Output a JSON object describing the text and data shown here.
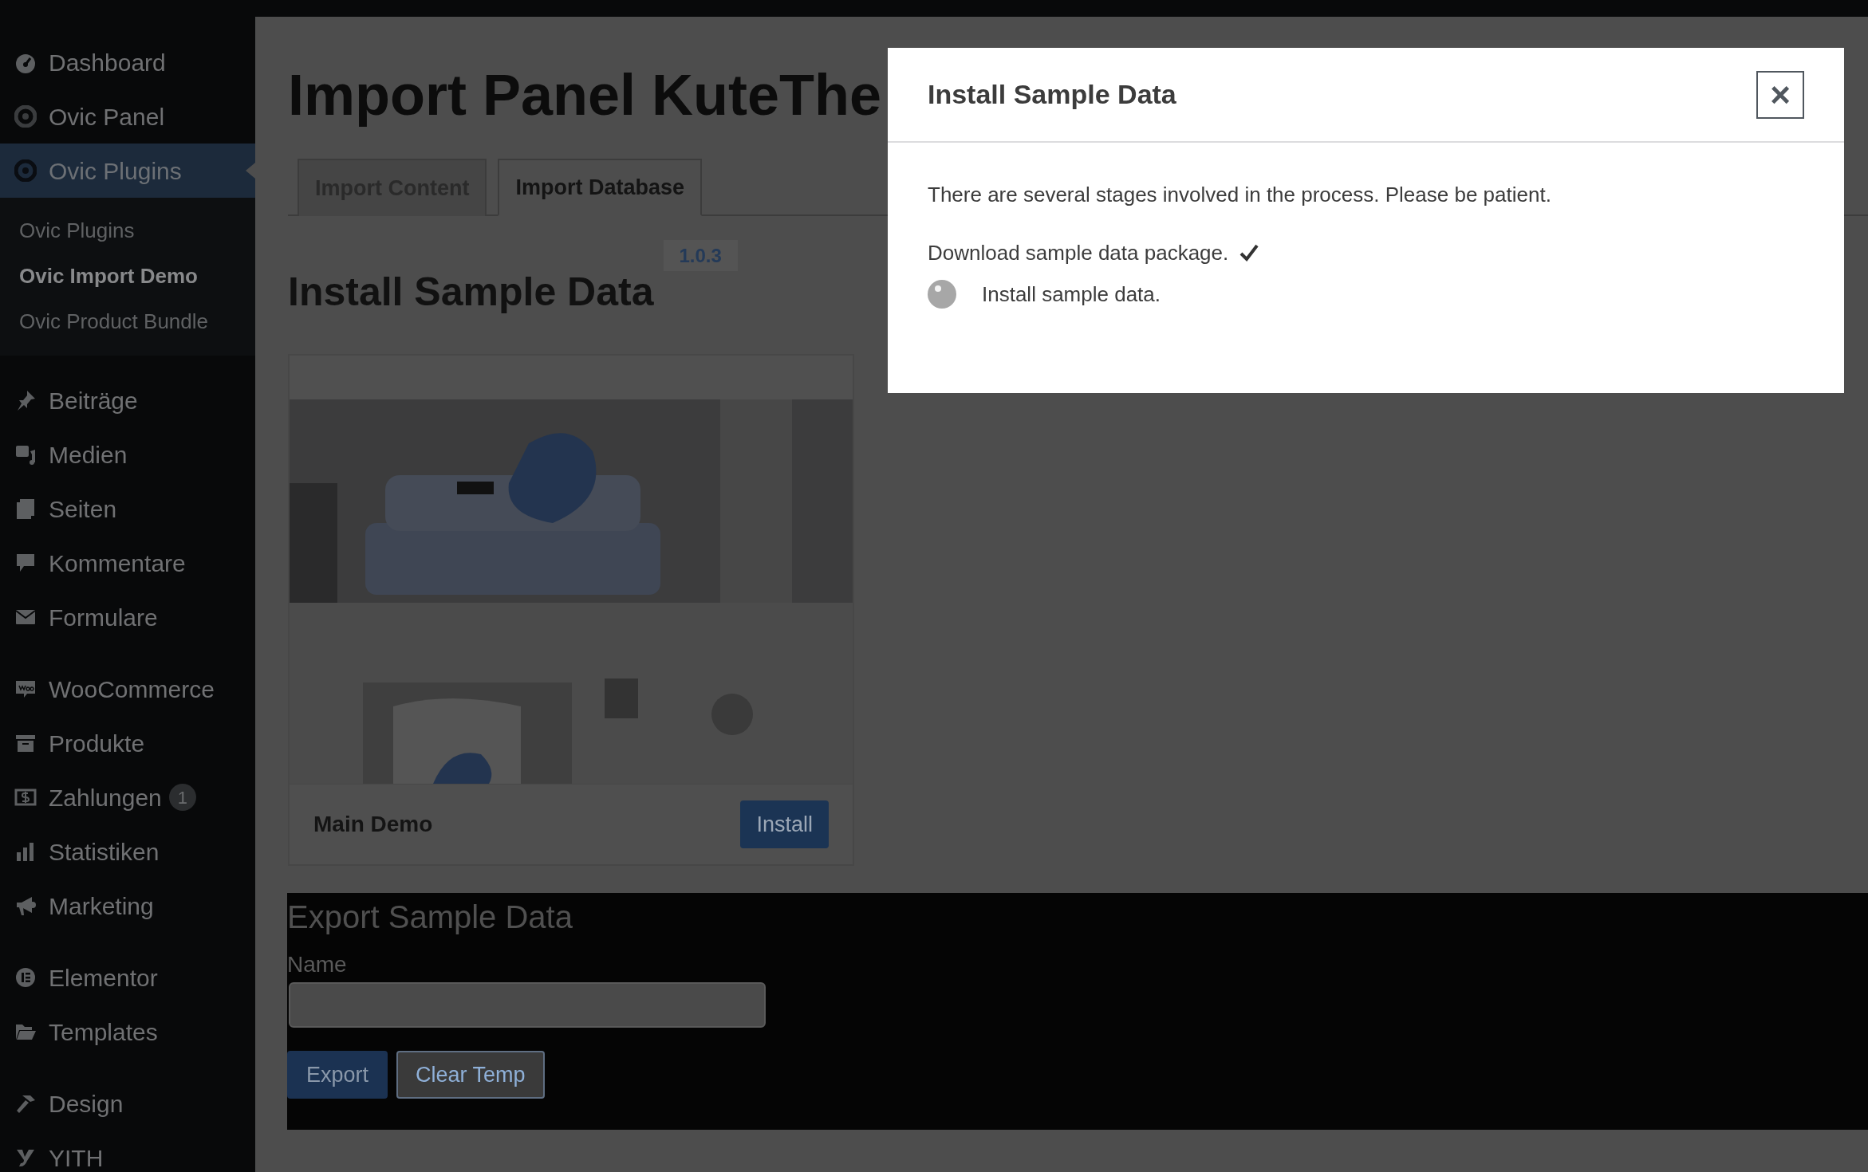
{
  "sidebar": {
    "groups": [
      [
        {
          "label": "Dashboard",
          "selected": false
        },
        {
          "label": "Ovic Panel",
          "selected": false
        },
        {
          "label": "Ovic Plugins",
          "selected": true,
          "children": [
            {
              "label": "Ovic Plugins",
              "selected": false
            },
            {
              "label": "Ovic Import Demo",
              "selected": true
            },
            {
              "label": "Ovic Product Bundle",
              "selected": false
            }
          ]
        }
      ],
      [
        {
          "label": "Beiträge",
          "selected": false
        },
        {
          "label": "Medien",
          "selected": false
        },
        {
          "label": "Seiten",
          "selected": false
        },
        {
          "label": "Kommentare",
          "selected": false
        },
        {
          "label": "Formulare",
          "selected": false
        }
      ],
      [
        {
          "label": "WooCommerce",
          "selected": false
        },
        {
          "label": "Produkte",
          "selected": false
        },
        {
          "label": "Zahlungen",
          "selected": false,
          "badge": "1"
        },
        {
          "label": "Statistiken",
          "selected": false
        },
        {
          "label": "Marketing",
          "selected": false
        }
      ],
      [
        {
          "label": "Elementor",
          "selected": false
        },
        {
          "label": "Templates",
          "selected": false
        }
      ],
      [
        {
          "label": "Design",
          "selected": false
        },
        {
          "label": "YITH",
          "selected": false
        }
      ]
    ]
  },
  "page": {
    "title": "Import Panel KuteThe",
    "tabs": [
      {
        "label": "Import Content",
        "selected": false
      },
      {
        "label": "Import Database",
        "selected": true
      }
    ],
    "section_title": "Install Sample Data",
    "version": "1.0.3",
    "demos": [
      {
        "kind": "picture",
        "name": "Main Demo",
        "button": "Install"
      }
    ],
    "export": {
      "title": "Export Sample Data",
      "field_label": "Name",
      "buttons": [
        {
          "label": "Export",
          "primary": true
        },
        {
          "label": "Clear Temp",
          "primary": false
        }
      ]
    }
  },
  "modal": {
    "title": "Install Sample Data",
    "close": "×",
    "intro": "There are several stages involved in the process. Please be patient.",
    "steps": [
      {
        "label": "Download sample data package.",
        "done": true
      },
      {
        "label": "Install sample data.",
        "done": false
      }
    ]
  }
}
